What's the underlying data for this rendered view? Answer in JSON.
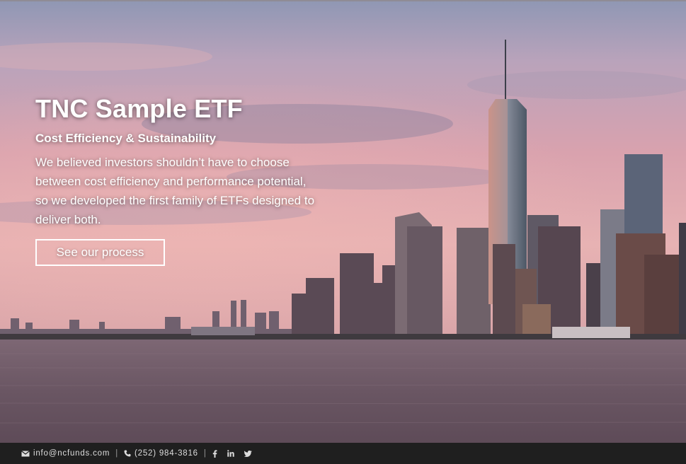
{
  "hero": {
    "title": "TNC Sample ETF",
    "subtitle": "Cost Efficiency & Sustainability",
    "text": "We believed investors shouldn’t have to choose between cost efficiency and performance potential, so we developed the first family of ETFs designed to deliver both.",
    "button_label": "See our process"
  },
  "footer": {
    "email": "info@ncfunds.com",
    "phone": "(252) 984-3816",
    "separator": "|",
    "icons": [
      "envelope-icon",
      "phone-icon",
      "facebook-icon",
      "linkedin-icon",
      "twitter-icon"
    ]
  },
  "colors": {
    "footer_bg": "#1f1f1f",
    "sky_top": "#8d97b8",
    "sky_pink": "#e3a6ad",
    "water": "#6e5b68"
  }
}
